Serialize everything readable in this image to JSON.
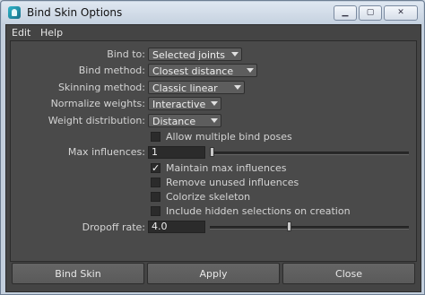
{
  "window": {
    "title": "Bind Skin Options"
  },
  "menu": [
    {
      "label": "Edit"
    },
    {
      "label": "Help"
    }
  ],
  "options": {
    "bind_to": {
      "label": "Bind to:",
      "value": "Selected joints"
    },
    "bind_method": {
      "label": "Bind method:",
      "value": "Closest distance"
    },
    "skinning_method": {
      "label": "Skinning method:",
      "value": "Classic linear"
    },
    "normalize_weights": {
      "label": "Normalize weights:",
      "value": "Interactive"
    },
    "weight_distribution": {
      "label": "Weight distribution:",
      "value": "Distance"
    },
    "allow_multiple_bind_poses": {
      "label": "Allow multiple bind poses",
      "checked": false
    },
    "max_influences": {
      "label": "Max influences:",
      "value": "1"
    },
    "maintain_max_influences": {
      "label": "Maintain max influences",
      "checked": true
    },
    "remove_unused_influences": {
      "label": "Remove unused influences",
      "checked": false
    },
    "colorize_skeleton": {
      "label": "Colorize skeleton",
      "checked": false
    },
    "include_hidden_selections": {
      "label": "Include hidden selections on creation",
      "checked": false
    },
    "dropoff_rate": {
      "label": "Dropoff rate:",
      "value": "4.0"
    }
  },
  "buttons": {
    "bind_skin": "Bind Skin",
    "apply": "Apply",
    "close": "Close"
  },
  "icons": {
    "app": "maya-app-icon",
    "minimize": "minimize-icon",
    "maximize": "maximize-icon",
    "close": "close-icon"
  }
}
